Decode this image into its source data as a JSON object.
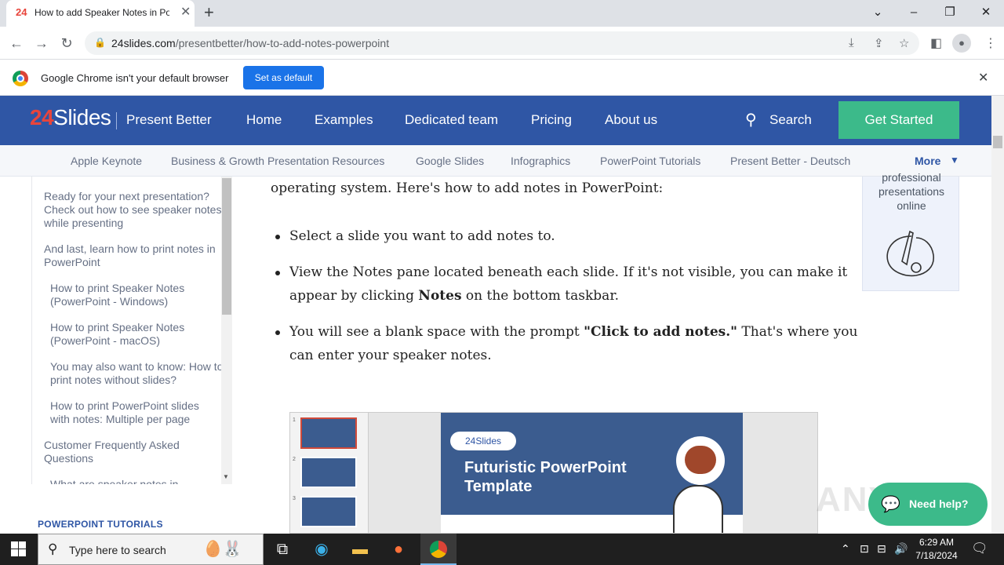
{
  "browser": {
    "tab_title": "How to add Speaker Notes in Po",
    "tab_favicon": "24",
    "new_tab": "+",
    "url_domain": "24slides.com",
    "url_path": "/presentbetter/how-to-add-notes-powerpoint"
  },
  "infobar": {
    "message": "Google Chrome isn't your default browser",
    "button": "Set as default"
  },
  "site": {
    "logo_num": "24",
    "logo_text": "Slides",
    "tagline": "Present Better",
    "nav": [
      "Home",
      "Examples",
      "Dedicated team",
      "Pricing",
      "About us"
    ],
    "search": "Search",
    "cta": "Get Started",
    "categories": [
      "Apple Keynote",
      "Business & Growth Presentation Resources",
      "Google Slides",
      "Infographics",
      "PowerPoint Tutorials",
      "Present Better - Deutsch"
    ],
    "more": "More"
  },
  "toc": {
    "items": [
      "Ready for your next presentation? Check out how to see speaker notes while presenting",
      "And last, learn how to print notes in PowerPoint",
      "How to print Speaker Notes (PowerPoint - Windows)",
      "How to print Speaker Notes (PowerPoint - macOS)",
      "You may also want to know: How to print notes without slides?",
      "How to print PowerPoint slides with notes: Multiple per page",
      "Customer Frequently Asked Questions",
      "What are speaker notes in"
    ],
    "section_label": "POWERPOINT TUTORIALS"
  },
  "article": {
    "intro": "operating system. Here's how to add notes in PowerPoint:",
    "bullet1": "Select a slide you want to add notes to.",
    "bullet2_a": "View the Notes pane located beneath each slide. If it's not visible, you can make it",
    "bullet2_b_pre": "appear by clicking ",
    "bullet2_b_bold": "Notes",
    "bullet2_b_post": " on the bottom taskbar.",
    "bullet3_a_pre": "You will see a blank space with the prompt ",
    "bullet3_a_bold": "\"Click to add notes.\"",
    "bullet3_a_post": " That's where you",
    "bullet3_b": "can enter your speaker notes."
  },
  "slide": {
    "logo": "24Slides",
    "title_line1": "Futuristic PowerPoint",
    "title_line2": "Template",
    "thumb_numbers": [
      "1",
      "2",
      "3"
    ]
  },
  "promo": {
    "line1": "professional",
    "line2": "presentations",
    "line3": "online"
  },
  "widgets": {
    "watermark": "ANY RUN",
    "help": "Need help?"
  },
  "taskbar": {
    "search_placeholder": "Type here to search",
    "time": "6:29 AM",
    "date": "7/18/2024"
  },
  "colors": {
    "brand_blue": "#2f56a5",
    "cta_green": "#3cba8a",
    "chrome_blue": "#1a73e8"
  }
}
